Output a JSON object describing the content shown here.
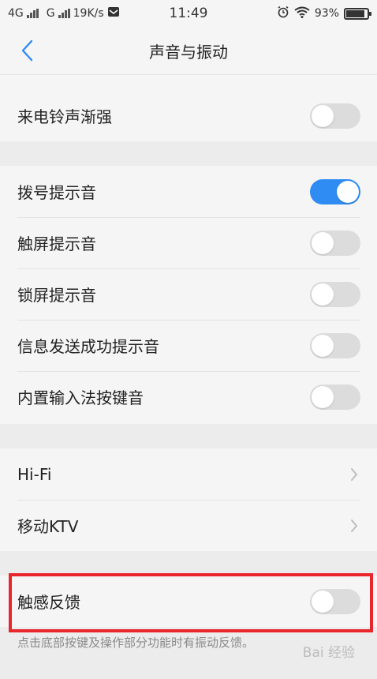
{
  "status_bar": {
    "network_1": "4G",
    "network_2": "G",
    "speed": "19K/s",
    "time": "11:49",
    "battery": "93%",
    "battery_level": 0.93,
    "icons": [
      "signal-icon",
      "message-icon",
      "alarm-icon",
      "wifi-icon",
      "battery-icon"
    ]
  },
  "header": {
    "title": "声音与振动",
    "back_icon": "chevron-left-icon",
    "accent": "#2f8cf3"
  },
  "sections": {
    "ring": {
      "label": "来电铃声渐强",
      "on": false
    },
    "tones": [
      {
        "label": "拨号提示音",
        "on": true
      },
      {
        "label": "触屏提示音",
        "on": false
      },
      {
        "label": "锁屏提示音",
        "on": false
      },
      {
        "label": "信息发送成功提示音",
        "on": false
      },
      {
        "label": "内置输入法按键音",
        "on": false
      }
    ],
    "audio": [
      {
        "label": "Hi-Fi"
      },
      {
        "label": "移动KTV"
      }
    ],
    "haptic": {
      "label": "触感反馈",
      "on": false
    }
  },
  "footnote": "点击底部按键及操作部分功能时有振动反馈。",
  "watermark": "Bai 经验",
  "colors": {
    "toggle_on": "#2f8cf3",
    "toggle_off": "#dcdcdc",
    "highlight": "#e8262c"
  }
}
